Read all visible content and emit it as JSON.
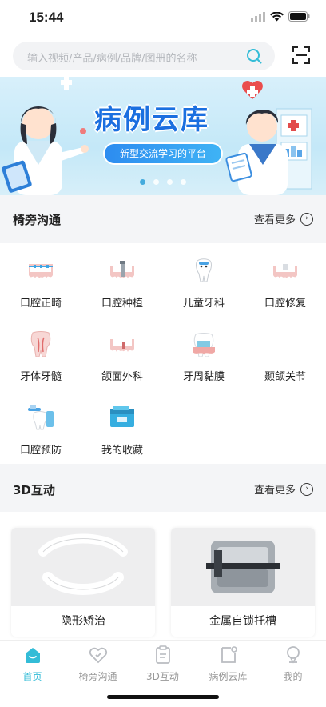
{
  "status": {
    "time": "15:44"
  },
  "search": {
    "placeholder": "输入视频/产品/病例/品牌/图册的名称"
  },
  "banner": {
    "title": "病例云库",
    "subtitle": "新型交流学习的平台",
    "dots": 4,
    "active_dot": 1
  },
  "sections": {
    "yipang": {
      "title": "椅旁沟通",
      "more": "查看更多"
    },
    "interactive": {
      "title": "3D互动",
      "more": "查看更多"
    }
  },
  "categories": [
    {
      "label": "口腔正畸",
      "icon": "orthodontics-icon"
    },
    {
      "label": "口腔种植",
      "icon": "implant-icon"
    },
    {
      "label": "儿童牙科",
      "icon": "pediatric-tooth-icon"
    },
    {
      "label": "口腔修复",
      "icon": "restoration-icon"
    },
    {
      "label": "牙体牙髓",
      "icon": "endodontics-icon"
    },
    {
      "label": "颌面外科",
      "icon": "maxillofacial-icon"
    },
    {
      "label": "牙周黏膜",
      "icon": "periodontal-icon"
    },
    {
      "label": "颞颌关节",
      "icon": "tmj-icon"
    },
    {
      "label": "口腔预防",
      "icon": "prevention-icon"
    },
    {
      "label": "我的收藏",
      "icon": "favorites-box-icon"
    }
  ],
  "cards": [
    {
      "label": "隐形矫治"
    },
    {
      "label": "金属自锁托槽"
    }
  ],
  "tabs": [
    {
      "label": "首页",
      "icon": "home-icon",
      "active": true
    },
    {
      "label": "椅旁沟通",
      "icon": "heart-chat-icon",
      "active": false
    },
    {
      "label": "3D互动",
      "icon": "clipboard-icon",
      "active": false
    },
    {
      "label": "病例云库",
      "icon": "document-icon",
      "active": false
    },
    {
      "label": "我的",
      "icon": "profile-icon",
      "active": false
    }
  ],
  "colors": {
    "accent": "#33bcd7",
    "banner_title": "#1b6fe0"
  }
}
